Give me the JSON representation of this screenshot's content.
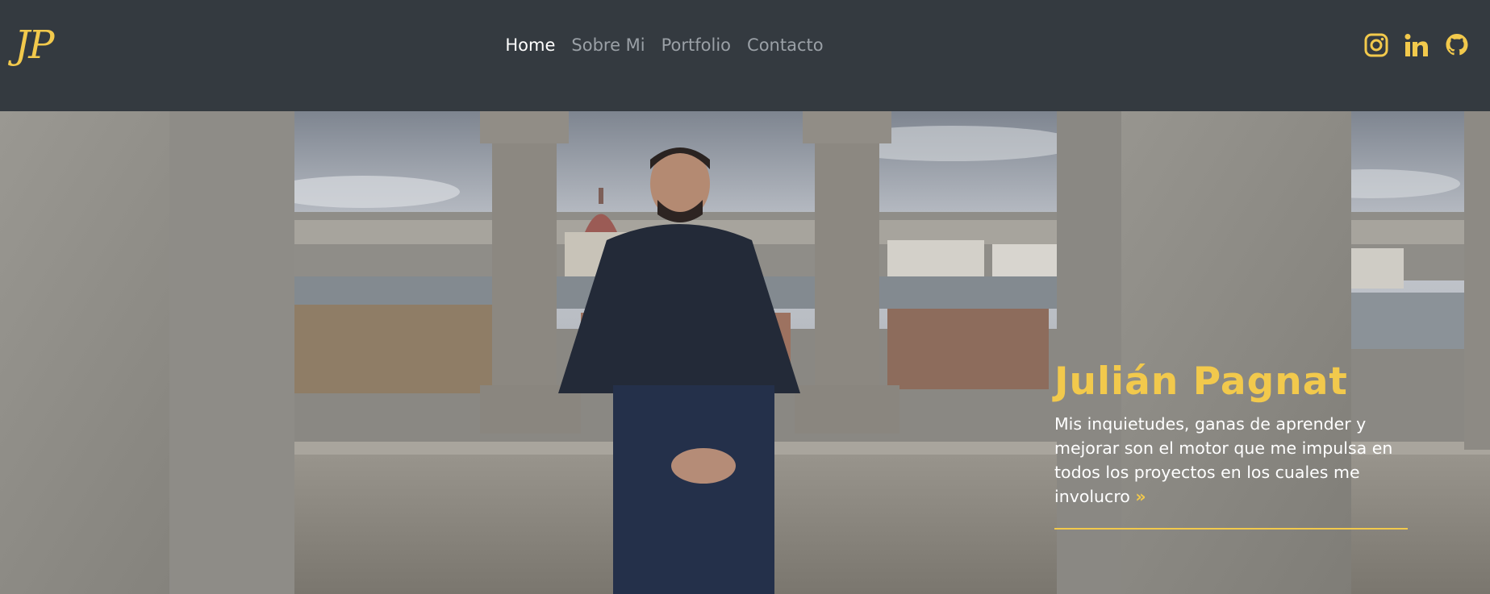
{
  "header": {
    "logo": "JP",
    "nav": [
      {
        "label": "Home",
        "active": true
      },
      {
        "label": "Sobre Mi",
        "active": false
      },
      {
        "label": "Portfolio",
        "active": false
      },
      {
        "label": "Contacto",
        "active": false
      }
    ],
    "social_icons": [
      "instagram-icon",
      "linkedin-icon",
      "github-icon"
    ]
  },
  "hero": {
    "name": "Julián Pagnat",
    "description": "Mis inquietudes, ganas de aprender y mejorar son el motor que me impulsa en todos los proyectos en los cuales me involucro",
    "link_icon": "double-chevron-right-icon"
  },
  "colors": {
    "accent": "#f2c94c",
    "navbar": "#343a40",
    "nav_active": "#ffffff",
    "nav_inactive": "#9aa0a6"
  }
}
